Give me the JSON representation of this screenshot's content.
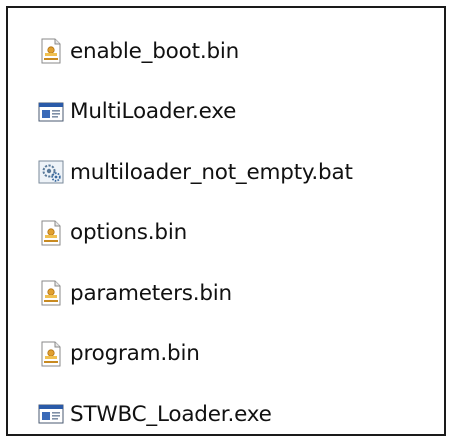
{
  "files": [
    {
      "name": "enable_boot.bin",
      "icon": "bin-file-icon"
    },
    {
      "name": "MultiLoader.exe",
      "icon": "exe-file-icon"
    },
    {
      "name": "multiloader_not_empty.bat",
      "icon": "bat-file-icon"
    },
    {
      "name": "options.bin",
      "icon": "bin-file-icon"
    },
    {
      "name": "parameters.bin",
      "icon": "bin-file-icon"
    },
    {
      "name": "program.bin",
      "icon": "bin-file-icon"
    },
    {
      "name": "STWBC_Loader.exe",
      "icon": "exe-file-icon"
    }
  ]
}
